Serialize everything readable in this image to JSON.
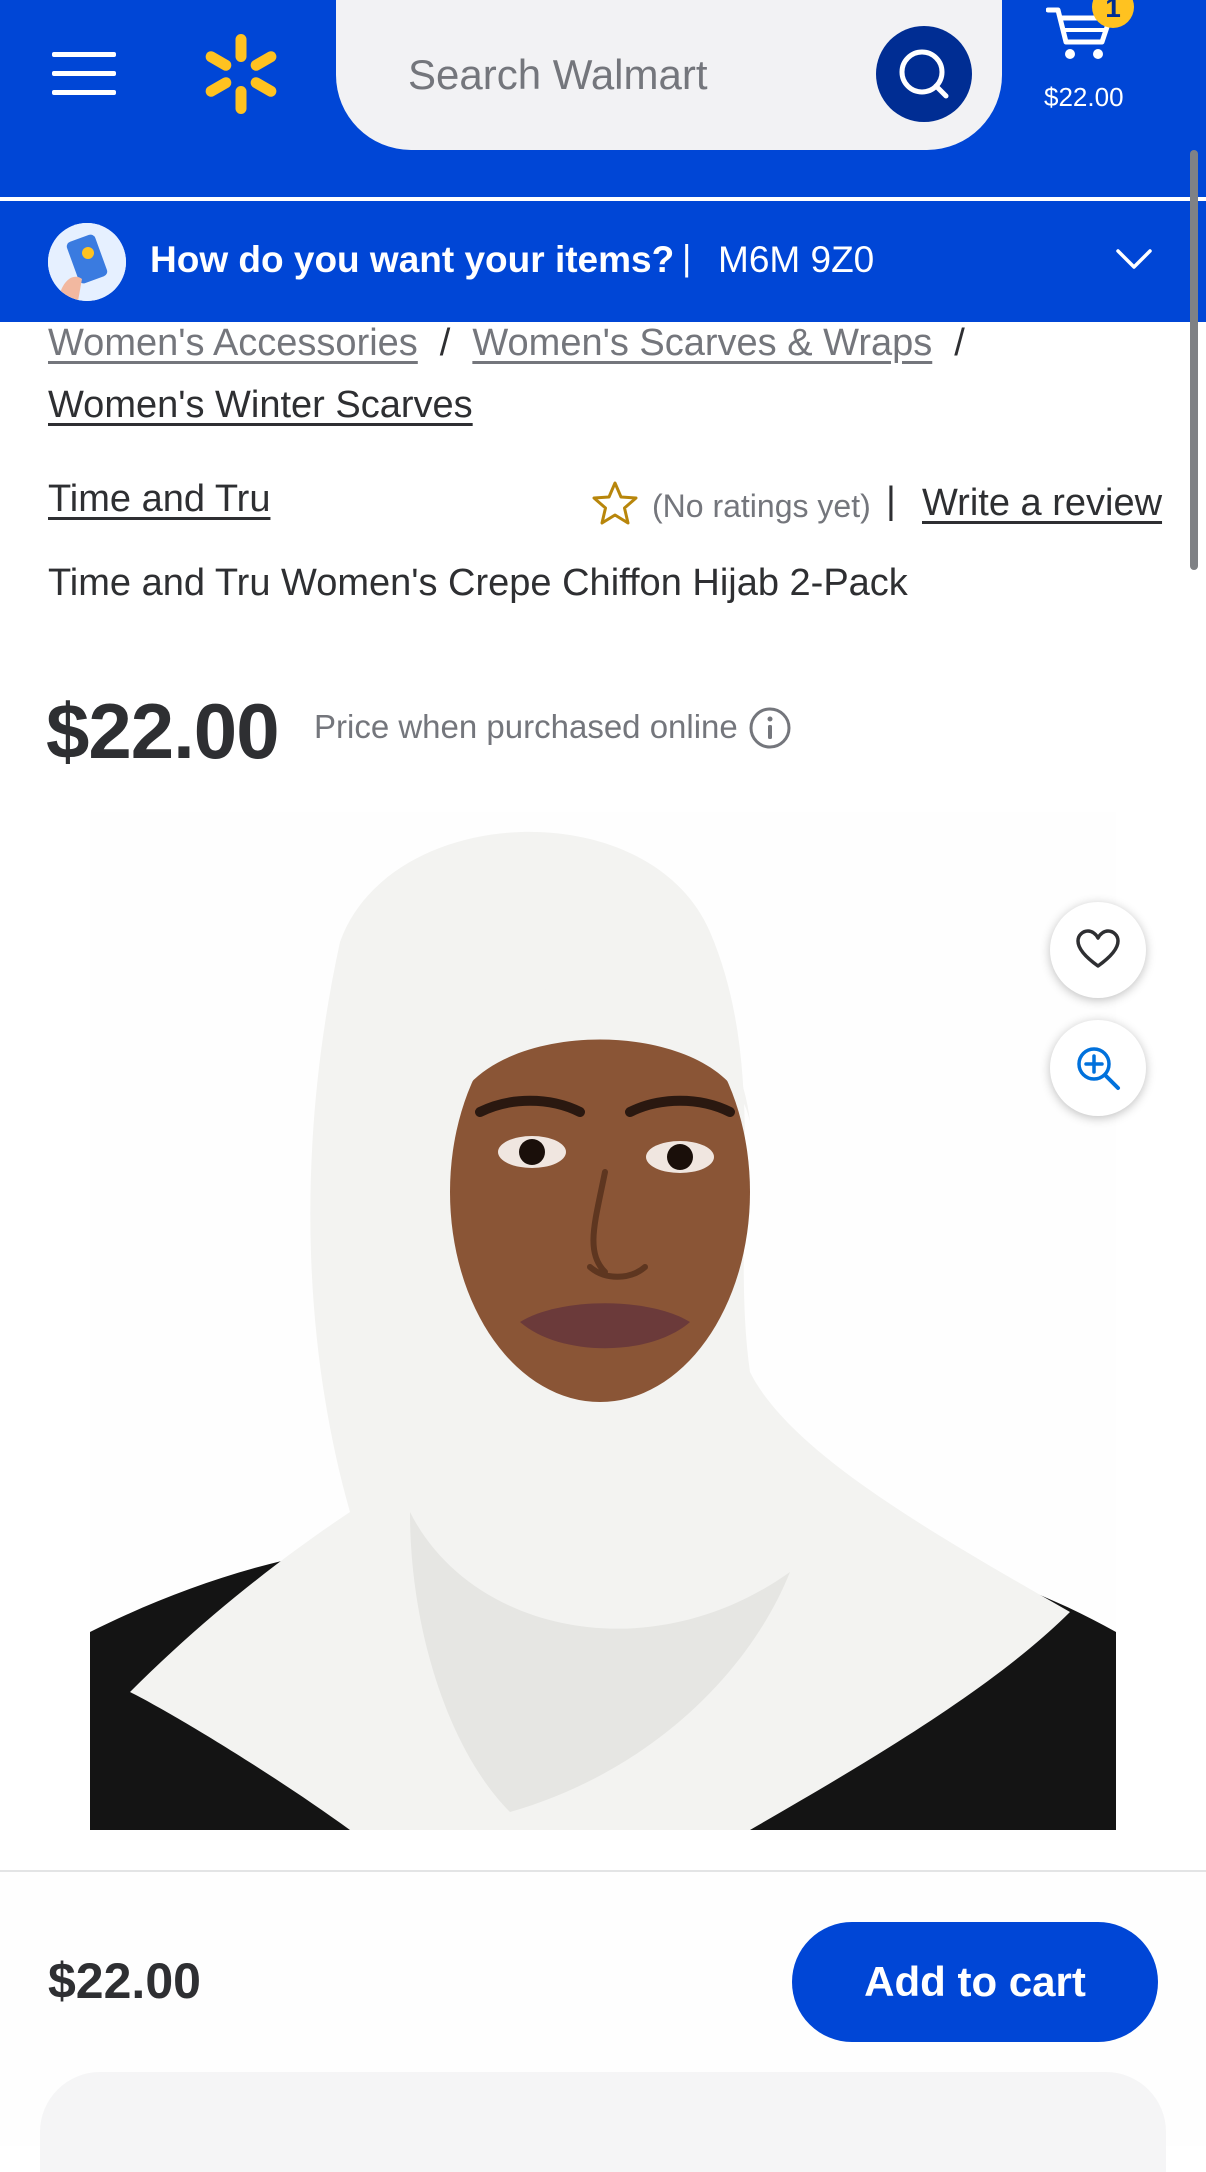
{
  "header": {
    "search_placeholder": "Search Walmart",
    "cart_count": "1",
    "cart_total": "$22.00"
  },
  "delivery": {
    "title": "How do you want your items?",
    "separator": "|",
    "postal_code": "M6M 9Z0"
  },
  "breadcrumb": {
    "items": [
      "Women's Accessories",
      "Women's Scarves & Wraps"
    ],
    "separator": "/",
    "current": "Women's Winter Scarves"
  },
  "product": {
    "brand": "Time and Tru",
    "rating_text": "(No ratings yet)",
    "rating_separator": "|",
    "review_link": "Write a review",
    "title": "Time and Tru Women's Crepe Chiffon Hijab 2-Pack",
    "price": "$22.00",
    "price_note": "Price when purchased online"
  },
  "bottom_bar": {
    "price": "$22.00",
    "add_to_cart_label": "Add to cart"
  },
  "icons": {
    "menu": "menu-icon",
    "logo": "walmart-spark-icon",
    "search": "search-icon",
    "cart": "cart-icon",
    "chevron": "chevron-down-icon",
    "star": "star-outline-icon",
    "info": "info-icon",
    "heart": "heart-icon",
    "zoom": "zoom-in-icon"
  },
  "colors": {
    "brand_blue": "#0046d6",
    "dark_blue": "#002d93",
    "spark_yellow": "#ffc220",
    "text": "#2e2f32",
    "muted_text": "#74767c",
    "star_gold": "#b8860b"
  }
}
